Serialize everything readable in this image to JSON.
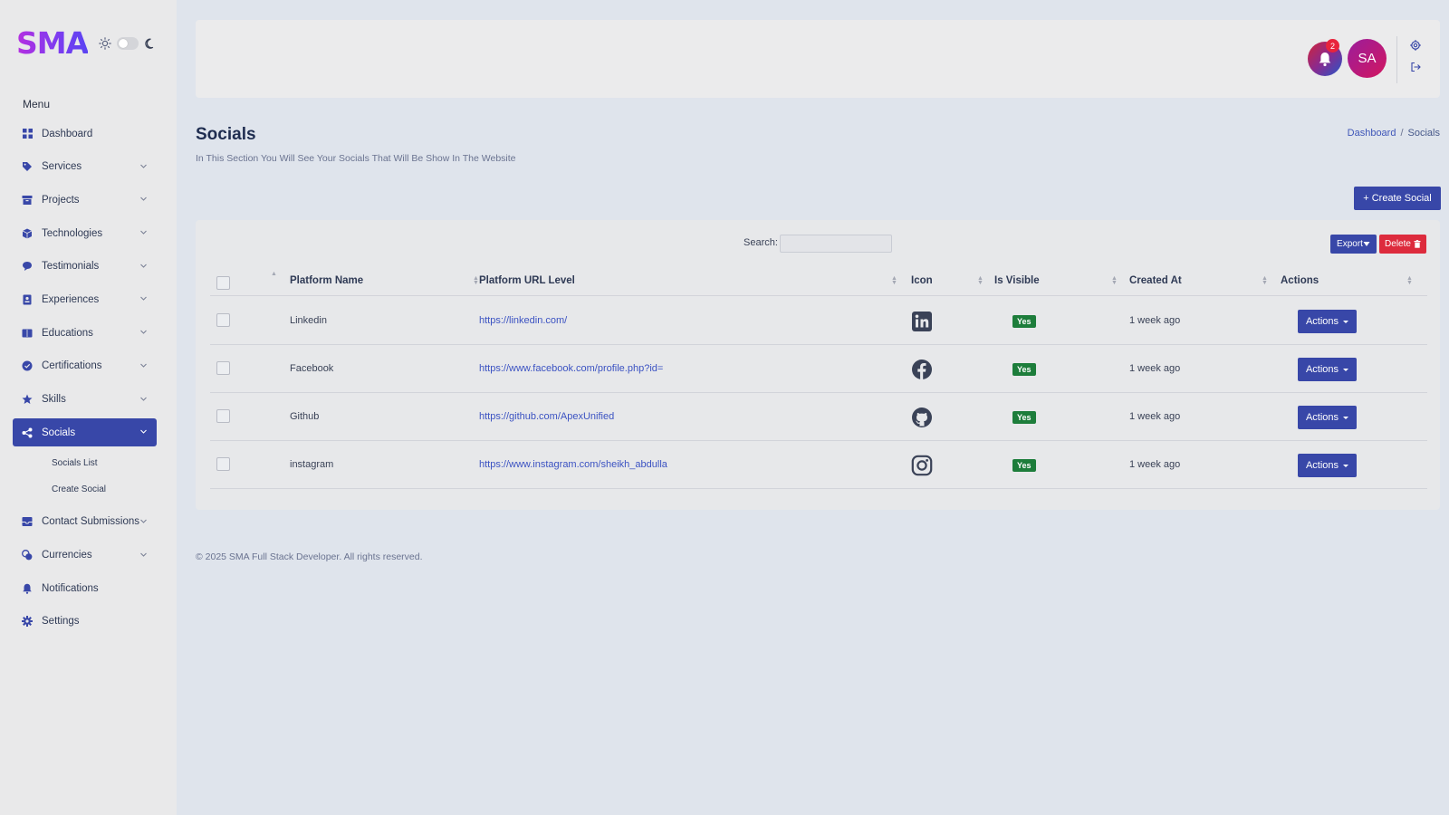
{
  "brand": {
    "logo": "SMA"
  },
  "sidebar": {
    "menu_heading": "Menu",
    "items": [
      {
        "label": "Dashboard",
        "icon": "dashboard-icon"
      },
      {
        "label": "Services",
        "icon": "tag-icon"
      },
      {
        "label": "Projects",
        "icon": "archive-icon"
      },
      {
        "label": "Technologies",
        "icon": "cube-icon"
      },
      {
        "label": "Testimonials",
        "icon": "chat-icon"
      },
      {
        "label": "Experiences",
        "icon": "id-card-icon"
      },
      {
        "label": "Educations",
        "icon": "book-icon"
      },
      {
        "label": "Certifications",
        "icon": "certificate-icon"
      },
      {
        "label": "Skills",
        "icon": "star-icon"
      },
      {
        "label": "Socials",
        "icon": "share-icon"
      },
      {
        "label": "Contact Submissions",
        "icon": "inbox-icon"
      },
      {
        "label": "Currencies",
        "icon": "coins-icon"
      },
      {
        "label": "Notifications",
        "icon": "bell-icon"
      },
      {
        "label": "Settings",
        "icon": "gear-icon"
      }
    ],
    "active": "Socials",
    "subitems": [
      "Socials List",
      "Create Social"
    ]
  },
  "header": {
    "notification_count": "2",
    "avatar_initials": "SA"
  },
  "page": {
    "title": "Socials",
    "subtitle": "In This Section You Will See Your Socials That Will Be Show In The Website",
    "breadcrumb_home": "Dashboard",
    "breadcrumb_sep": "/",
    "breadcrumb_current": "Socials",
    "create_button": "+ Create Social"
  },
  "table": {
    "search_label": "Search:",
    "export_label": "Export",
    "delete_label": "Delete",
    "columns": [
      "Platform Name",
      "Platform URL Level",
      "Icon",
      "Is Visible",
      "Created At",
      "Actions"
    ],
    "rows": [
      {
        "name": "Linkedin",
        "url": "https://linkedin.com/",
        "icon": "linkedin-icon",
        "visible": "Yes",
        "created": "1 week ago",
        "action": "Actions"
      },
      {
        "name": "Facebook",
        "url": "https://www.facebook.com/profile.php?id=",
        "icon": "facebook-icon",
        "visible": "Yes",
        "created": "1 week ago",
        "action": "Actions"
      },
      {
        "name": "Github",
        "url": "https://github.com/ApexUnified",
        "icon": "github-icon",
        "visible": "Yes",
        "created": "1 week ago",
        "action": "Actions"
      },
      {
        "name": "instagram",
        "url": "https://www.instagram.com/sheikh_abdulla",
        "icon": "instagram-icon",
        "visible": "Yes",
        "created": "1 week ago",
        "action": "Actions"
      }
    ]
  },
  "footer": {
    "text": "© 2025 SMA Full Stack Developer. All rights reserved."
  },
  "colors": {
    "primary": "#3847a8",
    "danger": "#dd2b3d",
    "success": "#1d7d3b"
  }
}
